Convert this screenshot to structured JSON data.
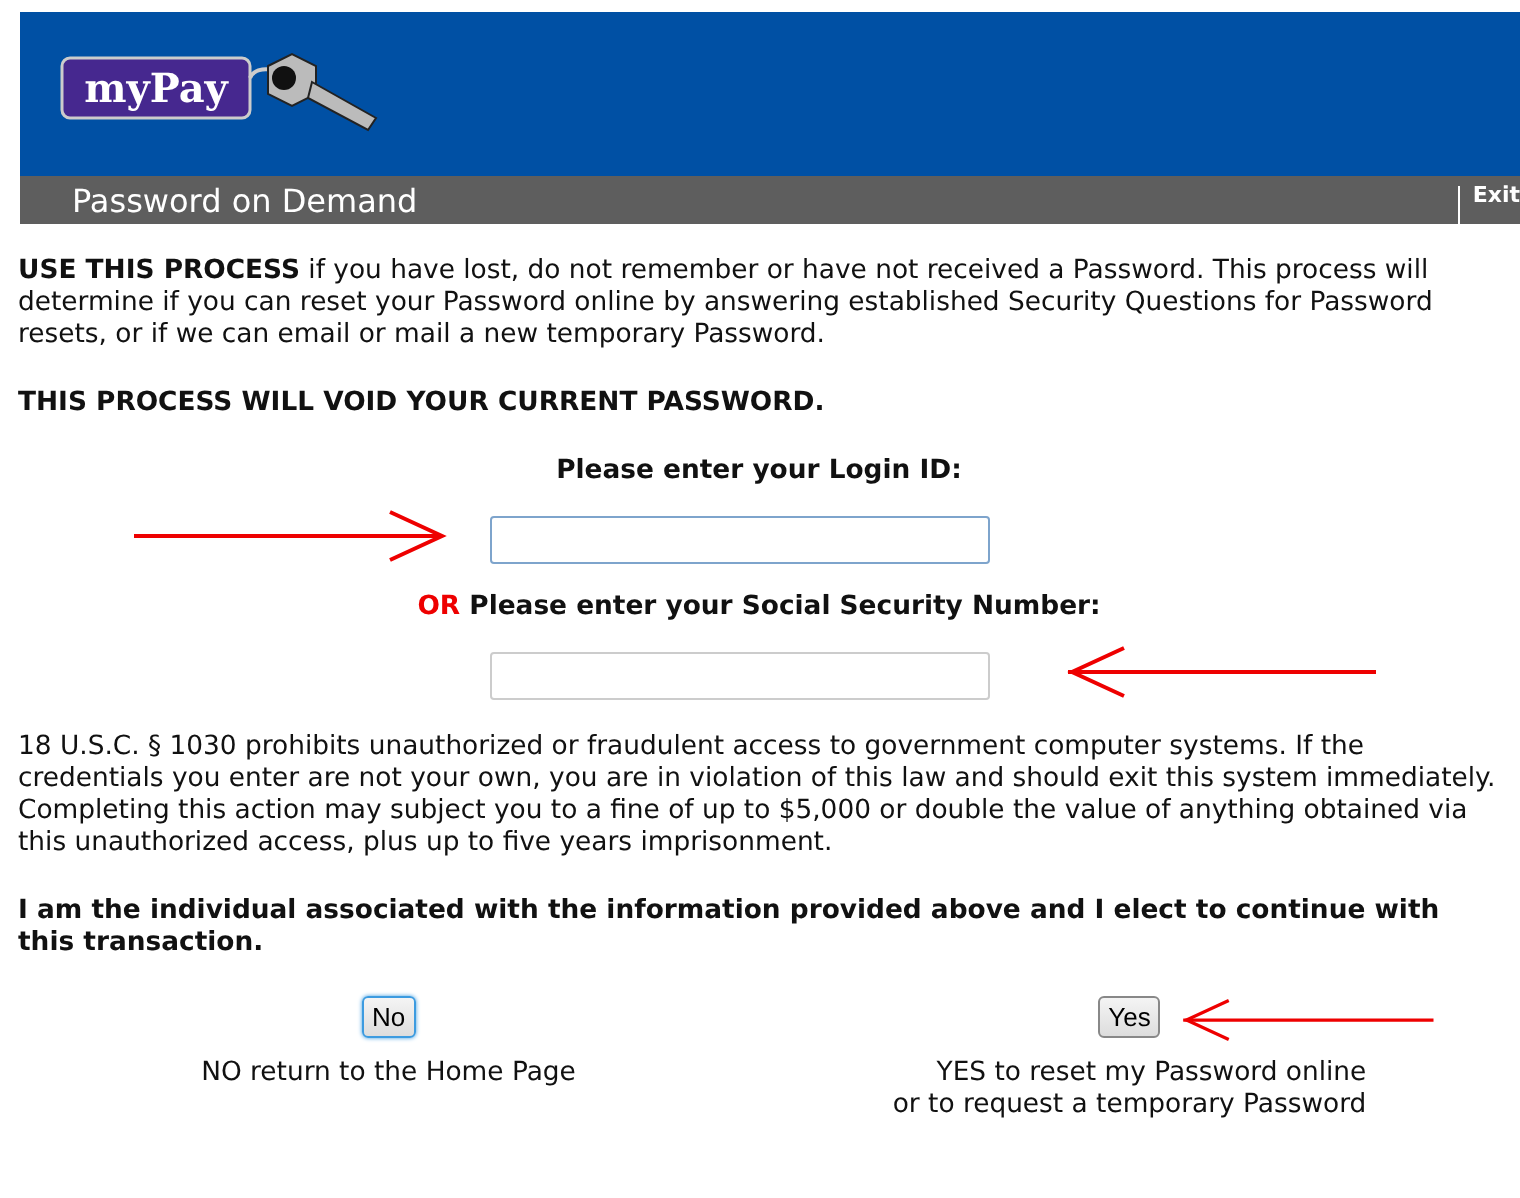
{
  "header": {
    "logo": "myPay",
    "title": "Password on Demand",
    "exit_link": "Exit"
  },
  "intro": "**USE THIS PROCESS** if you have lost, do not remember or have not received a Password. This process will determine if you can reset your Password online by answering established Security Questions for Password resets, or if we can email or mail a new temporary Password.",
  "warning": "THIS PROCESS WILL VOID YOUR CURRENT PASSWORD.",
  "fields": [
    {
      "label": "Please enter your Login ID:",
      "focused": true,
      "kind": "arrow_before"
    },
    {
      "prefix": "OR",
      "label": "Please enter your Social Security Number:",
      "focused": false,
      "kind": "arrow_after"
    }
  ],
  "legal": "18 U.S.C. § 1030 prohibits unauthorized or fraudulent access to government computer systems. If the credentials you enter are not your own, you are in violation of this law and should exit this system immediately. Completing this action may subject you to a fine of up to $5,000 or double the value of anything obtained via this unauthorized access, plus up to five years imprisonment.",
  "consent": "I am the individual associated with the information provided above and I elect to continue with this transaction.",
  "actions": [
    {
      "button": "No",
      "focused": true,
      "arrow": false,
      "caption": [
        "NO return to the Home Page"
      ]
    },
    {
      "button": "Yes",
      "focused": false,
      "arrow": true,
      "caption": [
        "YES to reset my Password online",
        "or to request a temporary Password"
      ]
    }
  ]
}
